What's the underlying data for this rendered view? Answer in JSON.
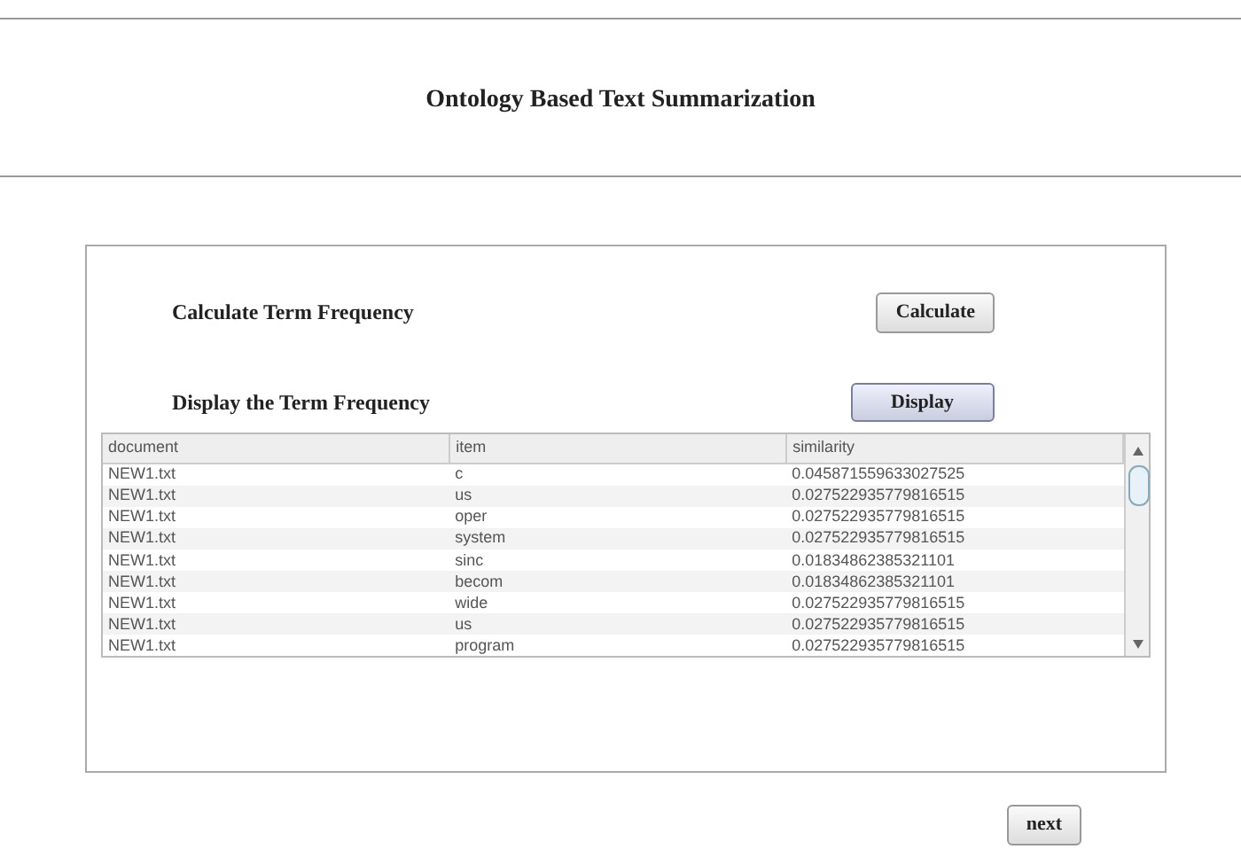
{
  "title": "Ontology Based Text Summarization",
  "actions": [
    {
      "label": "Calculate Term Frequency",
      "button": "Calculate",
      "selected": false
    },
    {
      "label": "Display the Term Frequency",
      "button": "Display",
      "selected": true
    }
  ],
  "table": {
    "columns": [
      "document",
      "item",
      "similarity"
    ],
    "rows": [
      [
        "NEW1.txt",
        "c",
        "0.045871559633027525"
      ],
      [
        "NEW1.txt",
        "us",
        "0.027522935779816515"
      ],
      [
        "NEW1.txt",
        "oper",
        "0.027522935779816515"
      ],
      [
        "NEW1.txt",
        "system",
        "0.027522935779816515"
      ],
      [
        "NEW1.txt",
        "sinc",
        "0.01834862385321101"
      ],
      [
        "NEW1.txt",
        "becom",
        "0.01834862385321101"
      ],
      [
        "NEW1.txt",
        "wide",
        "0.027522935779816515"
      ],
      [
        "NEW1.txt",
        "us",
        "0.027522935779816515"
      ],
      [
        "NEW1.txt",
        "program",
        "0.027522935779816515"
      ]
    ]
  },
  "next_button": "next"
}
